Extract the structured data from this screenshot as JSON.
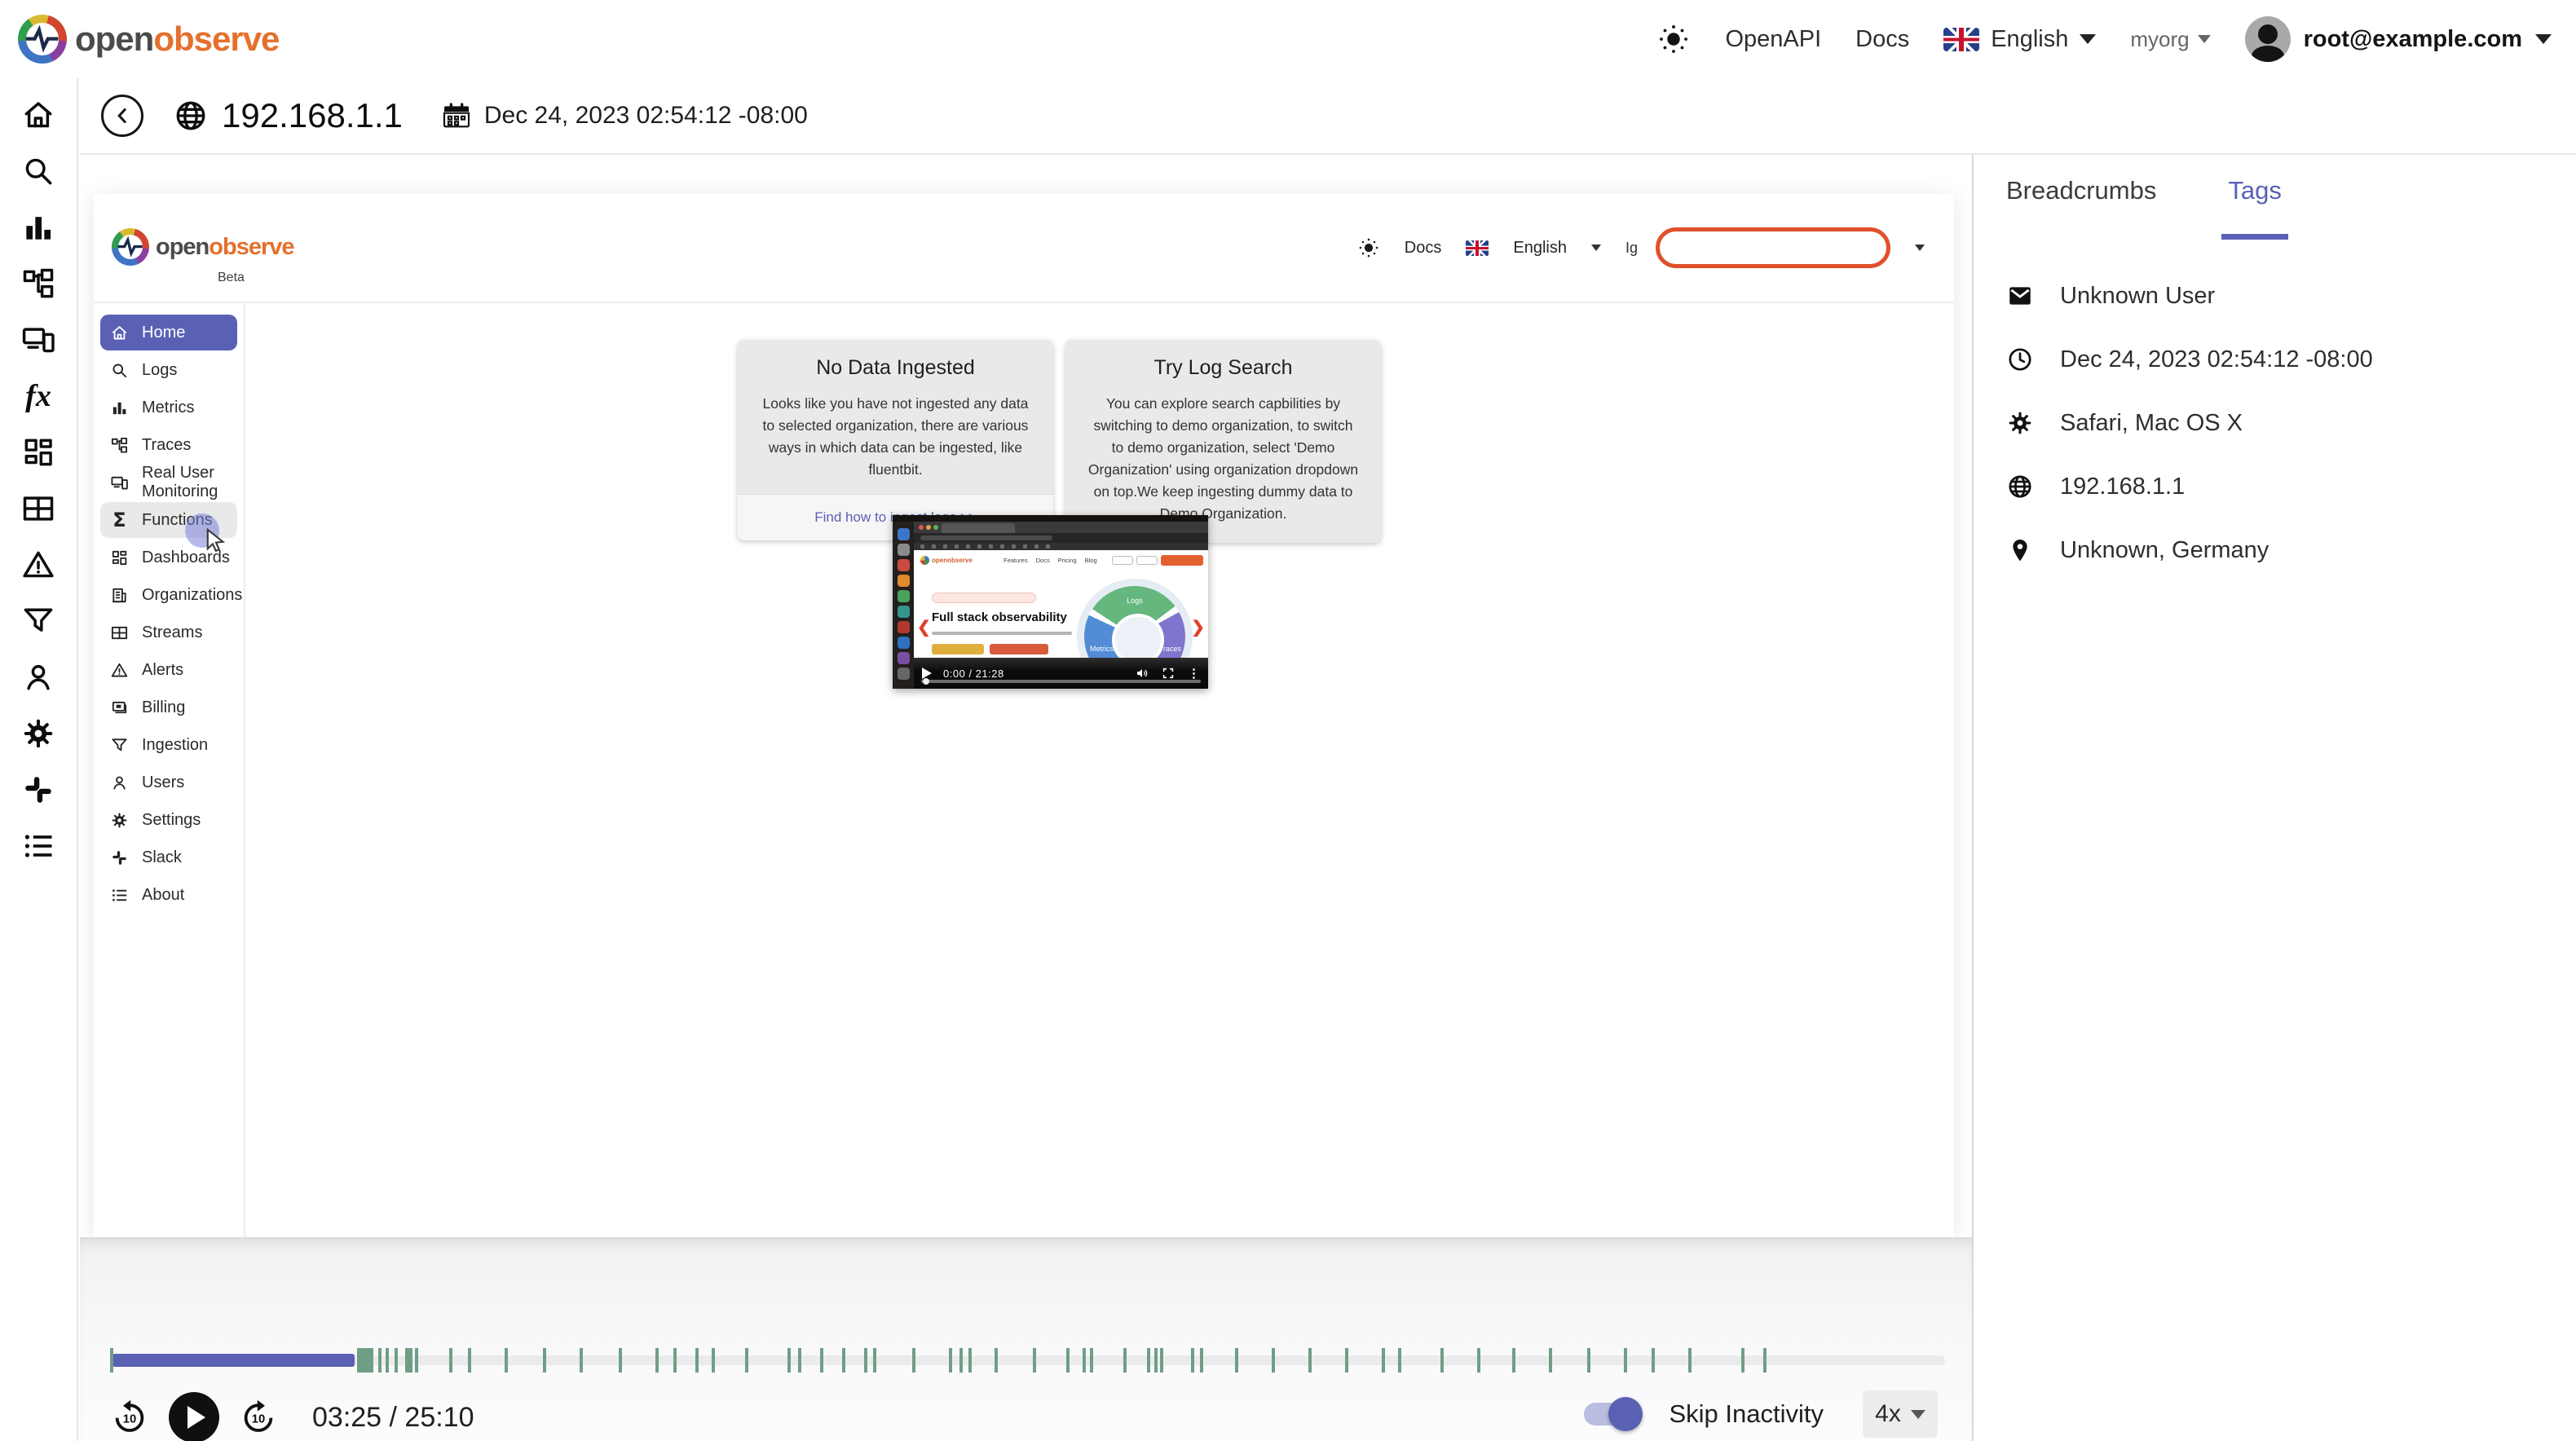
{
  "colors": {
    "accent": "#5a61b4",
    "green_tick": "#6f9e85",
    "highlight_red": "#e0502c",
    "link": "#5a61b4",
    "logo_orange": "#e4702e"
  },
  "header": {
    "logo_open": "open",
    "logo_observe": "observe",
    "openapi_label": "OpenAPI",
    "docs_label": "Docs",
    "language": "English",
    "org": "myorg",
    "user_email": "root@example.com"
  },
  "toolbar": {
    "session_ip": "192.168.1.1",
    "session_time": "Dec 24, 2023 02:54:12 -08:00"
  },
  "rail": {
    "items": [
      {
        "name": "home",
        "icon": "home"
      },
      {
        "name": "logs",
        "icon": "search"
      },
      {
        "name": "metrics",
        "icon": "metrics"
      },
      {
        "name": "traces",
        "icon": "traces"
      },
      {
        "name": "real-user-monitoring",
        "icon": "rum"
      },
      {
        "name": "functions",
        "icon": "fx"
      },
      {
        "name": "dashboards",
        "icon": "dashboards"
      },
      {
        "name": "streams",
        "icon": "streams"
      },
      {
        "name": "alerts",
        "icon": "alerts"
      },
      {
        "name": "ingestion",
        "icon": "ingestion"
      },
      {
        "name": "users",
        "icon": "users"
      },
      {
        "name": "settings",
        "icon": "gear"
      },
      {
        "name": "slack",
        "icon": "slack"
      },
      {
        "name": "about",
        "icon": "about"
      }
    ]
  },
  "side_panel": {
    "tabs": [
      {
        "label": "Breadcrumbs",
        "active": false
      },
      {
        "label": "Tags",
        "active": true
      }
    ],
    "tags": [
      {
        "icon": "envelope",
        "label": "Unknown User"
      },
      {
        "icon": "clock",
        "label": "Dec 24, 2023 02:54:12 -08:00"
      },
      {
        "icon": "gear",
        "label": "Safari, Mac OS X"
      },
      {
        "icon": "globe",
        "label": "192.168.1.1"
      },
      {
        "icon": "pin",
        "label": "Unknown, Germany"
      }
    ]
  },
  "replay": {
    "logo_open": "open",
    "logo_observe": "observe",
    "beta": "Beta",
    "header": {
      "docs": "Docs",
      "language": "English",
      "org_clipped": "Ig"
    },
    "sidebar": [
      {
        "label": "Home",
        "icon": "home",
        "state": "active"
      },
      {
        "label": "Logs",
        "icon": "search",
        "state": ""
      },
      {
        "label": "Metrics",
        "icon": "metrics",
        "state": ""
      },
      {
        "label": "Traces",
        "icon": "traces",
        "state": ""
      },
      {
        "label": "Real User Monitoring",
        "icon": "rum",
        "state": ""
      },
      {
        "label": "Functions",
        "icon": "sigma",
        "state": "hover"
      },
      {
        "label": "Dashboards",
        "icon": "dashboards",
        "state": ""
      },
      {
        "label": "Organizations",
        "icon": "orgs",
        "state": ""
      },
      {
        "label": "Streams",
        "icon": "streams",
        "state": ""
      },
      {
        "label": "Alerts",
        "icon": "alerts",
        "state": ""
      },
      {
        "label": "Billing",
        "icon": "billing",
        "state": ""
      },
      {
        "label": "Ingestion",
        "icon": "ingestion",
        "state": ""
      },
      {
        "label": "Users",
        "icon": "users",
        "state": ""
      },
      {
        "label": "Settings",
        "icon": "gear",
        "state": ""
      },
      {
        "label": "Slack",
        "icon": "slack",
        "state": ""
      },
      {
        "label": "About",
        "icon": "about",
        "state": ""
      }
    ],
    "cards": [
      {
        "title": "No Data Ingested",
        "body": "Looks like you have not ingested any data to selected organization, there are various ways in which data can be ingested, like fluentbit.",
        "link": "Find how to ingest logs >>"
      },
      {
        "title": "Try Log Search",
        "body": "You can explore search capbilities by switching to demo organization, to switch to demo organization, select 'Demo Organization' using organization dropdown on top.We keep ingesting dummy data to Demo Organization."
      }
    ],
    "video": {
      "headline": "Full stack observability",
      "time": "0:00 / 21:28",
      "donut_labels": [
        "Logs",
        "Metrics",
        "Traces"
      ],
      "nav_items": [
        "Features",
        "Docs",
        "Pricing",
        "Blog"
      ],
      "dock_colors": [
        "#3a76c9",
        "#8a8a8a",
        "#c94b3f",
        "#e08a2e",
        "#4aa15c",
        "#35958f",
        "#b03a30",
        "#2e6fbf",
        "#7a4fa0",
        "#666666"
      ]
    }
  },
  "player": {
    "time_display": "03:25 / 25:10",
    "skip_label": "Skip Inactivity",
    "speed": "4x",
    "progress_percent": 13.2,
    "ticks": [
      {
        "p": 0
      },
      {
        "p": 13.45,
        "w": 20
      },
      {
        "p": 14.6
      },
      {
        "p": 15.0
      },
      {
        "p": 15.5
      },
      {
        "p": 16.1,
        "w": 9
      },
      {
        "p": 16.6
      },
      {
        "p": 18.5
      },
      {
        "p": 19.5
      },
      {
        "p": 21.5
      },
      {
        "p": 23.6
      },
      {
        "p": 25.6
      },
      {
        "p": 27.7
      },
      {
        "p": 29.7
      },
      {
        "p": 30.7
      },
      {
        "p": 31.9
      },
      {
        "p": 32.8
      },
      {
        "p": 34.6
      },
      {
        "p": 36.9
      },
      {
        "p": 37.5
      },
      {
        "p": 38.7
      },
      {
        "p": 39.9
      },
      {
        "p": 41.1
      },
      {
        "p": 41.6
      },
      {
        "p": 43.7
      },
      {
        "p": 45.7
      },
      {
        "p": 46.3
      },
      {
        "p": 46.8
      },
      {
        "p": 48.2
      },
      {
        "p": 50.3
      },
      {
        "p": 52.1
      },
      {
        "p": 53.0
      },
      {
        "p": 53.4
      },
      {
        "p": 55.2
      },
      {
        "p": 56.5
      },
      {
        "p": 56.9
      },
      {
        "p": 57.2
      },
      {
        "p": 58.9
      },
      {
        "p": 59.4
      },
      {
        "p": 61.3
      },
      {
        "p": 63.3
      },
      {
        "p": 65.3
      },
      {
        "p": 67.3
      },
      {
        "p": 69.3
      },
      {
        "p": 70.2
      },
      {
        "p": 72.5
      },
      {
        "p": 74.5
      },
      {
        "p": 76.4
      },
      {
        "p": 78.4
      },
      {
        "p": 80.5
      },
      {
        "p": 82.5
      },
      {
        "p": 84.0
      },
      {
        "p": 86.0
      },
      {
        "p": 88.9
      },
      {
        "p": 90.1
      }
    ]
  }
}
